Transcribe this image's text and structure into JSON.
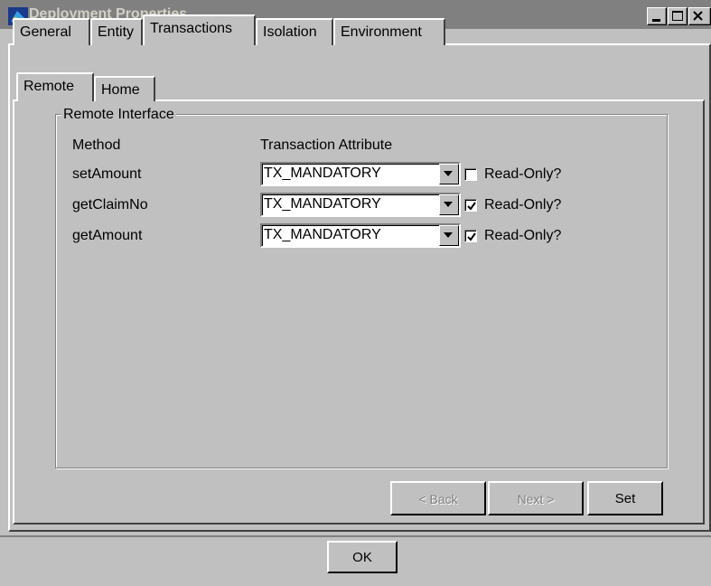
{
  "window": {
    "title": "Deployment Properties"
  },
  "tabs": [
    {
      "label": "General"
    },
    {
      "label": "Entity"
    },
    {
      "label": "Transactions"
    },
    {
      "label": "Isolation"
    },
    {
      "label": "Environment"
    }
  ],
  "subtabs": [
    {
      "label": "Remote"
    },
    {
      "label": "Home"
    }
  ],
  "group": {
    "title": "Remote Interface",
    "col_method": "Method",
    "col_attr": "Transaction Attribute"
  },
  "rows": [
    {
      "method": "setAmount",
      "attribute": "TX_MANDATORY",
      "readonly_label": "Read-Only?",
      "readonly": false
    },
    {
      "method": "getClaimNo",
      "attribute": "TX_MANDATORY",
      "readonly_label": "Read-Only?",
      "readonly": true
    },
    {
      "method": "getAmount",
      "attribute": "TX_MANDATORY",
      "readonly_label": "Read-Only?",
      "readonly": true
    }
  ],
  "buttons": {
    "back": "< Back",
    "next": "Next >",
    "set": "Set",
    "ok": "OK"
  }
}
